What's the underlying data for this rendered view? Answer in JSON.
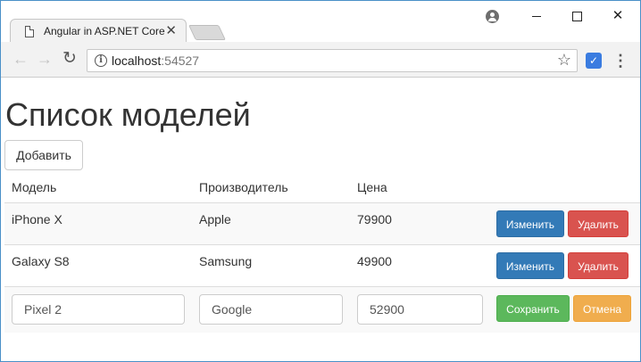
{
  "browser": {
    "tab_title": "Angular in ASP.NET Core",
    "url_host": "localhost",
    "url_port": ":54527"
  },
  "page": {
    "title": "Список моделей",
    "add_button": "Добавить",
    "columns": [
      "Модель",
      "Производитель",
      "Цена"
    ],
    "rows": [
      {
        "model": "iPhone X",
        "manufacturer": "Apple",
        "price": "79900",
        "edit": "Изменить",
        "delete": "Удалить"
      },
      {
        "model": "Galaxy S8",
        "manufacturer": "Samsung",
        "price": "49900",
        "edit": "Изменить",
        "delete": "Удалить"
      }
    ],
    "edit_row": {
      "model": "Pixel 2",
      "manufacturer": "Google",
      "price": "52900",
      "save": "Сохранить",
      "cancel": "Отмена"
    }
  },
  "colors": {
    "primary": "#337ab7",
    "danger": "#d9534f",
    "success": "#5cb85c",
    "warning": "#f0ad4e"
  }
}
